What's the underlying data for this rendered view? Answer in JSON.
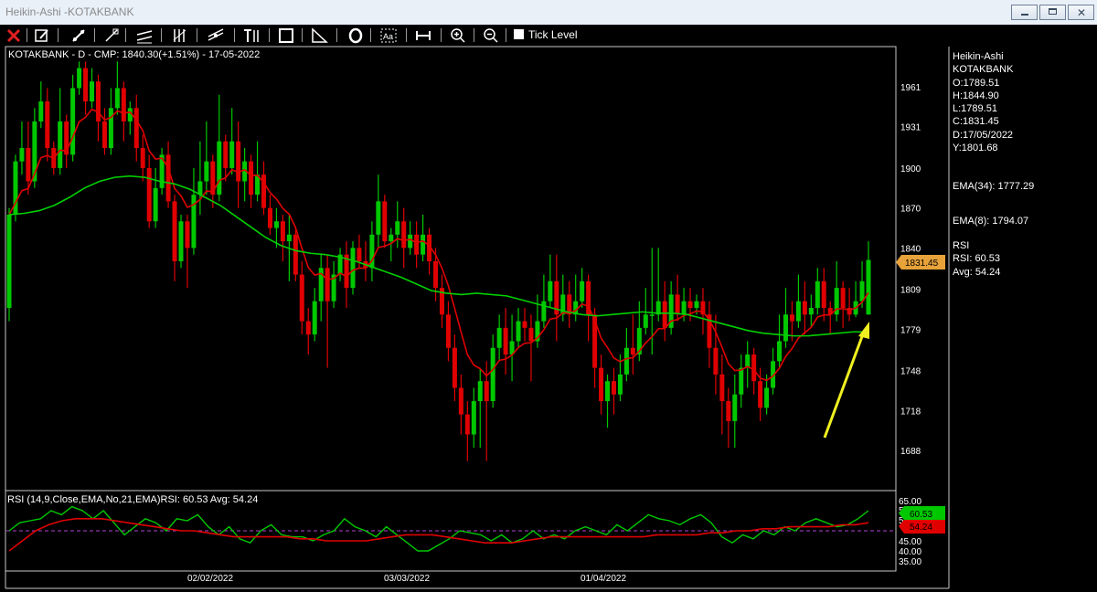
{
  "window": {
    "title": "Heikin-Ashi -KOTAKBANK"
  },
  "toolbar": {
    "tick_level_label": "Tick Level",
    "icons": [
      "close-icon",
      "edit-icon",
      "trendline-icon",
      "ray-icon",
      "parallel-channel-icon",
      "fibonacci-icon",
      "regression-icon",
      "text-tool-icon",
      "rectangle-icon",
      "angle-icon",
      "ellipse-icon",
      "text-label-icon",
      "measure-icon",
      "zoom-in-icon",
      "zoom-out-icon"
    ]
  },
  "chart": {
    "header": "KOTAKBANK - D - CMP: 1840.30(+1.51%) - 17-05-2022",
    "rsi_header": "RSI (14,9,Close,EMA,No,21,EMA)RSI: 60.53 Avg: 54.24",
    "price_ticks": [
      "1961",
      "1931",
      "1900",
      "1870",
      "1840",
      "1809",
      "1779",
      "1748",
      "1718",
      "1688"
    ],
    "current_price_badge": "1831.45",
    "rsi_ticks": [
      "65.00",
      "55.00",
      "50.00",
      "45.00",
      "40.00",
      "35.00"
    ],
    "rsi_badge": "60.53",
    "avg_badge": "54.24",
    "date_labels": [
      "02/02/2022",
      "03/03/2022",
      "01/04/2022"
    ]
  },
  "info_panel": {
    "chart_type": "Heikin-Ashi",
    "symbol": "KOTAKBANK",
    "open": "O:1789.51",
    "high": "H:1844.90",
    "low": "L:1789.51",
    "close": "C:1831.45",
    "date": "D:17/05/2022",
    "prev": "Y:1801.68",
    "ema34": "EMA(34): 1777.29",
    "ema8": "EMA(8): 1794.07",
    "rsi_title": "RSI",
    "rsi_value": "RSI: 60.53",
    "rsi_avg": "Avg: 54.24"
  },
  "colors": {
    "bull": "#00c800",
    "bear": "#e00000",
    "ema_fast": "#e00000",
    "ema_slow": "#00d000",
    "badge_price": "#e8a23a",
    "arrow": "#f0f020",
    "rsi_midline": "#b040d0"
  },
  "candles": [
    [
      1795,
      1865,
      1785,
      1870
    ],
    [
      1865,
      1905,
      1860,
      1910
    ],
    [
      1905,
      1915,
      1895,
      1935
    ],
    [
      1915,
      1890,
      1880,
      1935
    ],
    [
      1890,
      1935,
      1885,
      1945
    ],
    [
      1935,
      1950,
      1930,
      1965
    ],
    [
      1950,
      1915,
      1905,
      1960
    ],
    [
      1915,
      1900,
      1895,
      1920
    ],
    [
      1900,
      1935,
      1895,
      1960
    ],
    [
      1935,
      1910,
      1900,
      1940
    ],
    [
      1910,
      1960,
      1905,
      1970
    ],
    [
      1960,
      1975,
      1955,
      1980
    ],
    [
      1975,
      1950,
      1940,
      1980
    ],
    [
      1950,
      1965,
      1945,
      1975
    ],
    [
      1965,
      1935,
      1920,
      1970
    ],
    [
      1935,
      1915,
      1910,
      1945
    ],
    [
      1915,
      1945,
      1910,
      1960
    ],
    [
      1945,
      1960,
      1940,
      1980
    ],
    [
      1960,
      1935,
      1920,
      1965
    ],
    [
      1935,
      1945,
      1925,
      1950
    ],
    [
      1945,
      1915,
      1905,
      1955
    ],
    [
      1915,
      1900,
      1890,
      1925
    ],
    [
      1900,
      1860,
      1855,
      1910
    ],
    [
      1860,
      1885,
      1855,
      1900
    ],
    [
      1885,
      1910,
      1880,
      1915
    ],
    [
      1910,
      1875,
      1870,
      1920
    ],
    [
      1875,
      1830,
      1815,
      1880
    ],
    [
      1830,
      1860,
      1825,
      1865
    ],
    [
      1860,
      1840,
      1810,
      1865
    ],
    [
      1840,
      1880,
      1835,
      1900
    ],
    [
      1880,
      1890,
      1865,
      1920
    ],
    [
      1890,
      1905,
      1880,
      1935
    ],
    [
      1905,
      1880,
      1870,
      1910
    ],
    [
      1880,
      1920,
      1875,
      1955
    ],
    [
      1920,
      1900,
      1890,
      1925
    ],
    [
      1900,
      1920,
      1895,
      1945
    ],
    [
      1920,
      1890,
      1870,
      1935
    ],
    [
      1890,
      1905,
      1875,
      1915
    ],
    [
      1905,
      1880,
      1870,
      1910
    ],
    [
      1880,
      1895,
      1875,
      1920
    ],
    [
      1895,
      1870,
      1865,
      1905
    ],
    [
      1870,
      1855,
      1850,
      1880
    ],
    [
      1855,
      1860,
      1840,
      1870
    ],
    [
      1860,
      1845,
      1830,
      1865
    ],
    [
      1845,
      1850,
      1815,
      1865
    ],
    [
      1850,
      1820,
      1815,
      1855
    ],
    [
      1820,
      1785,
      1775,
      1830
    ],
    [
      1785,
      1775,
      1760,
      1795
    ],
    [
      1775,
      1800,
      1770,
      1810
    ],
    [
      1800,
      1825,
      1785,
      1835
    ],
    [
      1825,
      1800,
      1750,
      1835
    ],
    [
      1800,
      1820,
      1795,
      1830
    ],
    [
      1820,
      1835,
      1815,
      1840
    ],
    [
      1835,
      1810,
      1795,
      1845
    ],
    [
      1810,
      1840,
      1805,
      1845
    ],
    [
      1840,
      1830,
      1825,
      1850
    ],
    [
      1830,
      1825,
      1815,
      1845
    ],
    [
      1825,
      1850,
      1815,
      1860
    ],
    [
      1850,
      1875,
      1840,
      1895
    ],
    [
      1875,
      1845,
      1840,
      1880
    ],
    [
      1845,
      1850,
      1830,
      1855
    ],
    [
      1850,
      1860,
      1840,
      1875
    ],
    [
      1860,
      1840,
      1825,
      1870
    ],
    [
      1840,
      1850,
      1835,
      1860
    ],
    [
      1850,
      1835,
      1825,
      1860
    ],
    [
      1835,
      1850,
      1830,
      1865
    ],
    [
      1850,
      1830,
      1820,
      1855
    ],
    [
      1830,
      1810,
      1800,
      1840
    ],
    [
      1810,
      1790,
      1780,
      1820
    ],
    [
      1790,
      1765,
      1755,
      1800
    ],
    [
      1765,
      1735,
      1725,
      1775
    ],
    [
      1735,
      1715,
      1700,
      1745
    ],
    [
      1715,
      1700,
      1680,
      1725
    ],
    [
      1700,
      1725,
      1690,
      1735
    ],
    [
      1725,
      1740,
      1690,
      1750
    ],
    [
      1740,
      1725,
      1680,
      1755
    ],
    [
      1725,
      1765,
      1720,
      1775
    ],
    [
      1765,
      1780,
      1755,
      1790
    ],
    [
      1780,
      1760,
      1745,
      1795
    ],
    [
      1760,
      1770,
      1740,
      1790
    ],
    [
      1770,
      1785,
      1765,
      1795
    ],
    [
      1785,
      1780,
      1770,
      1795
    ],
    [
      1780,
      1770,
      1740,
      1790
    ],
    [
      1770,
      1785,
      1765,
      1805
    ],
    [
      1785,
      1800,
      1780,
      1820
    ],
    [
      1800,
      1815,
      1795,
      1835
    ],
    [
      1815,
      1790,
      1770,
      1835
    ],
    [
      1790,
      1805,
      1785,
      1820
    ],
    [
      1805,
      1790,
      1780,
      1815
    ],
    [
      1790,
      1800,
      1785,
      1820
    ],
    [
      1800,
      1815,
      1795,
      1825
    ],
    [
      1815,
      1790,
      1770,
      1820
    ],
    [
      1790,
      1750,
      1735,
      1795
    ],
    [
      1750,
      1725,
      1715,
      1760
    ],
    [
      1725,
      1740,
      1705,
      1745
    ],
    [
      1740,
      1730,
      1715,
      1750
    ],
    [
      1730,
      1745,
      1725,
      1760
    ],
    [
      1745,
      1765,
      1740,
      1780
    ],
    [
      1765,
      1760,
      1745,
      1790
    ],
    [
      1760,
      1780,
      1755,
      1800
    ],
    [
      1780,
      1790,
      1775,
      1810
    ],
    [
      1790,
      1790,
      1760,
      1840
    ],
    [
      1790,
      1800,
      1785,
      1840
    ],
    [
      1800,
      1780,
      1770,
      1815
    ],
    [
      1780,
      1805,
      1775,
      1815
    ],
    [
      1805,
      1790,
      1785,
      1820
    ],
    [
      1790,
      1800,
      1785,
      1810
    ],
    [
      1800,
      1795,
      1785,
      1810
    ],
    [
      1795,
      1800,
      1790,
      1805
    ],
    [
      1800,
      1790,
      1775,
      1810
    ],
    [
      1790,
      1765,
      1750,
      1800
    ],
    [
      1765,
      1745,
      1730,
      1790
    ],
    [
      1745,
      1725,
      1700,
      1760
    ],
    [
      1725,
      1710,
      1690,
      1735
    ],
    [
      1710,
      1730,
      1690,
      1745
    ],
    [
      1730,
      1750,
      1720,
      1760
    ],
    [
      1750,
      1760,
      1735,
      1770
    ],
    [
      1760,
      1740,
      1730,
      1765
    ],
    [
      1740,
      1720,
      1710,
      1750
    ],
    [
      1720,
      1735,
      1715,
      1745
    ],
    [
      1735,
      1755,
      1730,
      1765
    ],
    [
      1755,
      1770,
      1750,
      1790
    ],
    [
      1770,
      1790,
      1765,
      1810
    ],
    [
      1790,
      1785,
      1770,
      1800
    ],
    [
      1785,
      1800,
      1780,
      1820
    ],
    [
      1800,
      1790,
      1775,
      1815
    ],
    [
      1790,
      1795,
      1780,
      1805
    ],
    [
      1795,
      1815,
      1790,
      1825
    ],
    [
      1815,
      1795,
      1785,
      1825
    ],
    [
      1795,
      1790,
      1775,
      1800
    ],
    [
      1790,
      1810,
      1785,
      1830
    ],
    [
      1810,
      1795,
      1780,
      1815
    ],
    [
      1795,
      1790,
      1785,
      1810
    ],
    [
      1790,
      1800,
      1788,
      1815
    ],
    [
      1800,
      1815,
      1795,
      1830
    ],
    [
      1790,
      1831,
      1790,
      1845
    ]
  ],
  "ema34_series": [
    1865,
    1866,
    1868,
    1872,
    1878,
    1885,
    1890,
    1893,
    1894,
    1893,
    1890,
    1888,
    1884,
    1878,
    1872,
    1864,
    1856,
    1848,
    1842,
    1838,
    1836,
    1835,
    1833,
    1830,
    1826,
    1822,
    1818,
    1813,
    1808,
    1806,
    1805,
    1806,
    1805,
    1804,
    1801,
    1798,
    1795,
    1792,
    1790,
    1789,
    1790,
    1791,
    1792,
    1791,
    1791,
    1790,
    1787,
    1784,
    1781,
    1778,
    1776,
    1775,
    1774,
    1774,
    1775,
    1776,
    1777,
    1777
  ],
  "rsi_series": [
    50,
    54,
    55,
    56,
    60,
    58,
    62,
    60,
    56,
    60,
    54,
    48,
    52,
    56,
    54,
    50,
    56,
    55,
    58,
    52,
    48,
    52,
    46,
    44,
    50,
    53,
    48,
    47,
    47,
    45,
    48,
    50,
    56,
    52,
    50,
    47,
    52,
    48,
    44,
    40,
    40,
    43,
    46,
    50,
    49,
    48,
    45,
    48,
    44,
    46,
    50,
    46,
    48,
    46,
    50,
    52,
    50,
    48,
    53,
    50,
    54,
    58,
    56,
    55,
    53,
    56,
    58,
    54,
    47,
    44,
    48,
    46,
    50,
    48,
    52,
    50,
    54,
    56,
    54,
    52,
    53,
    56,
    60
  ],
  "rsi_avg_series": [
    40,
    45,
    50,
    53,
    55,
    56,
    56,
    56,
    55,
    54,
    53,
    52,
    51,
    50,
    50,
    49,
    48,
    47,
    47,
    47,
    47,
    47,
    46,
    46,
    45,
    45,
    45,
    45,
    46,
    47,
    48,
    48,
    48,
    47,
    46,
    45,
    44,
    44,
    44,
    45,
    46,
    47,
    47,
    47,
    47,
    47,
    47,
    47,
    47,
    48,
    48,
    48,
    48,
    49,
    49,
    50,
    50,
    51,
    51,
    52,
    52,
    52,
    52,
    53,
    53,
    54
  ]
}
